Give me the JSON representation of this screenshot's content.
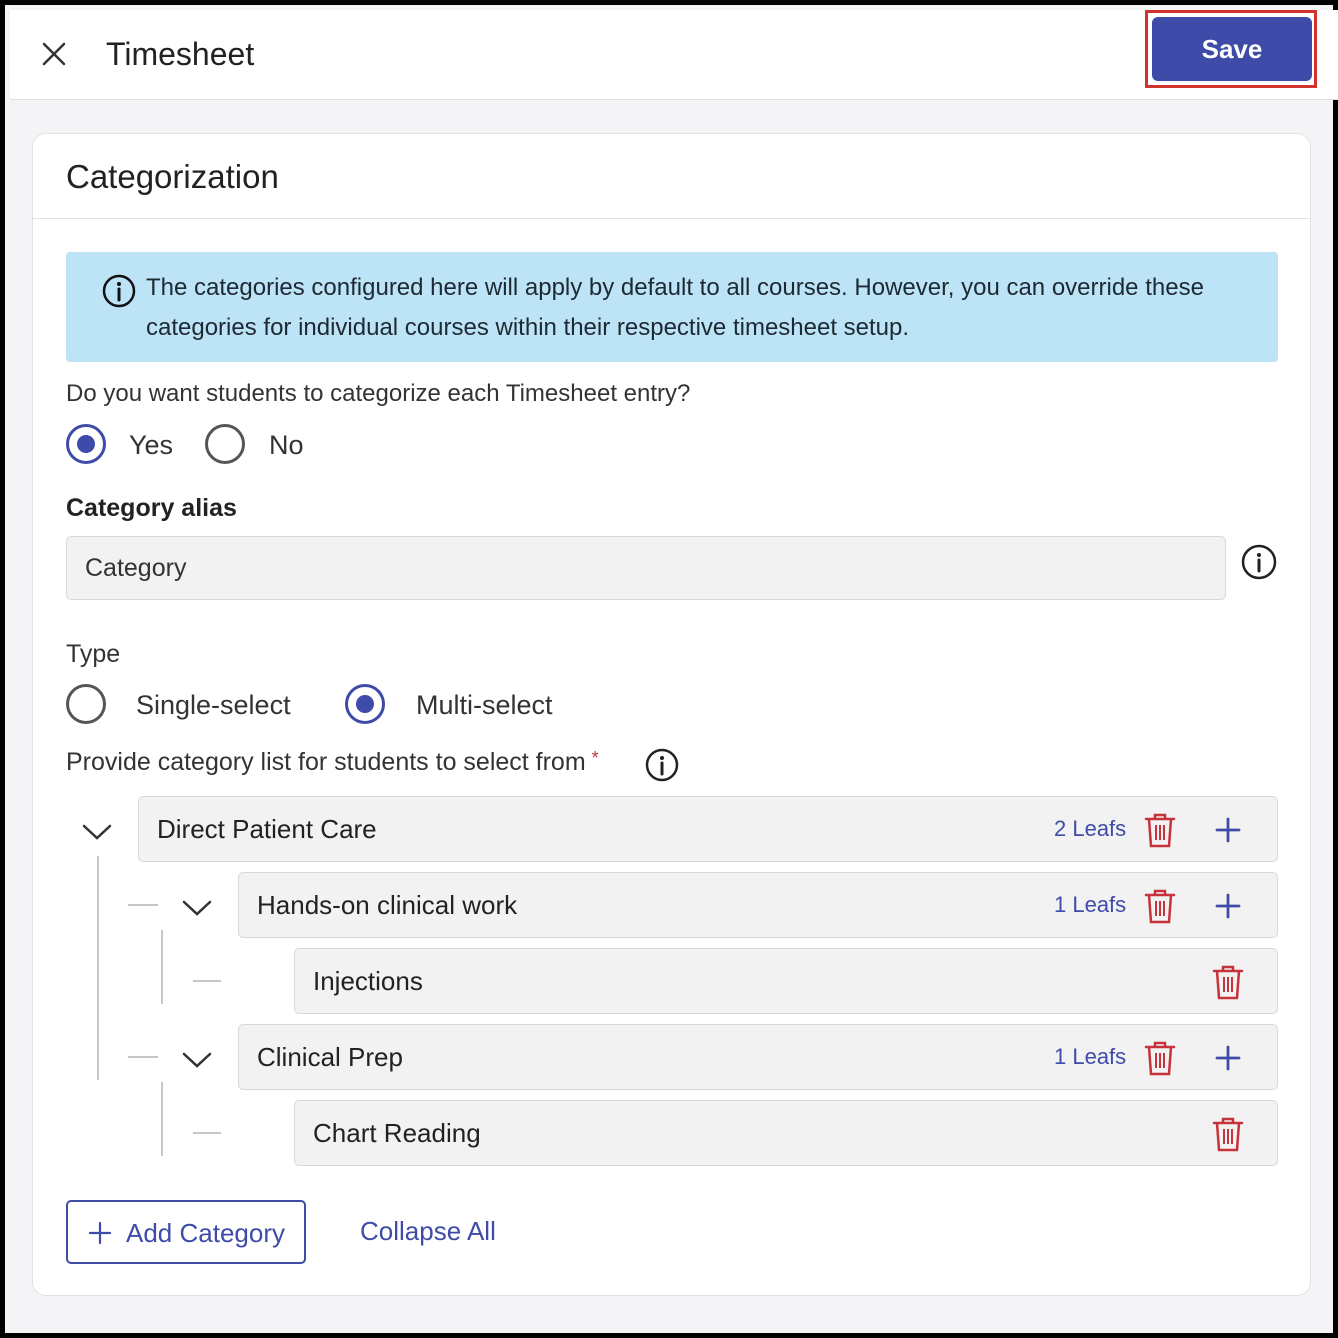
{
  "header": {
    "title": "Timesheet",
    "save_label": "Save"
  },
  "card": {
    "title": "Categorization",
    "info_text": "The categories configured here will apply by default to all courses. However, you can override these categories for individual courses within their respective timesheet setup."
  },
  "categorize": {
    "question": "Do you want students to categorize each Timesheet entry?",
    "options": [
      {
        "label": "Yes",
        "selected": true
      },
      {
        "label": "No",
        "selected": false
      }
    ]
  },
  "alias": {
    "label": "Category alias",
    "value": "Category"
  },
  "type": {
    "label": "Type",
    "options": [
      {
        "label": "Single-select",
        "selected": false
      },
      {
        "label": "Multi-select",
        "selected": true
      }
    ]
  },
  "category_list": {
    "label": "Provide category list for students to select from",
    "required_mark": "*",
    "items": [
      {
        "label": "Direct Patient Care",
        "leafs": "2 Leafs"
      },
      {
        "label": "Hands-on clinical work",
        "leafs": "1 Leafs"
      },
      {
        "label": "Injections"
      },
      {
        "label": "Clinical Prep",
        "leafs": "1 Leafs"
      },
      {
        "label": "Chart Reading"
      }
    ]
  },
  "actions": {
    "add_category": "Add Category",
    "collapse_all": "Collapse All"
  },
  "colors": {
    "primary": "#3f4ba9",
    "info_bg": "#bde3f6",
    "delete": "#c7333b",
    "highlight": "#d0342c"
  },
  "icons": {
    "close": "close-icon",
    "info": "info-icon",
    "chevron": "chevron-down-icon",
    "trash": "trash-icon",
    "plus": "plus-icon"
  }
}
